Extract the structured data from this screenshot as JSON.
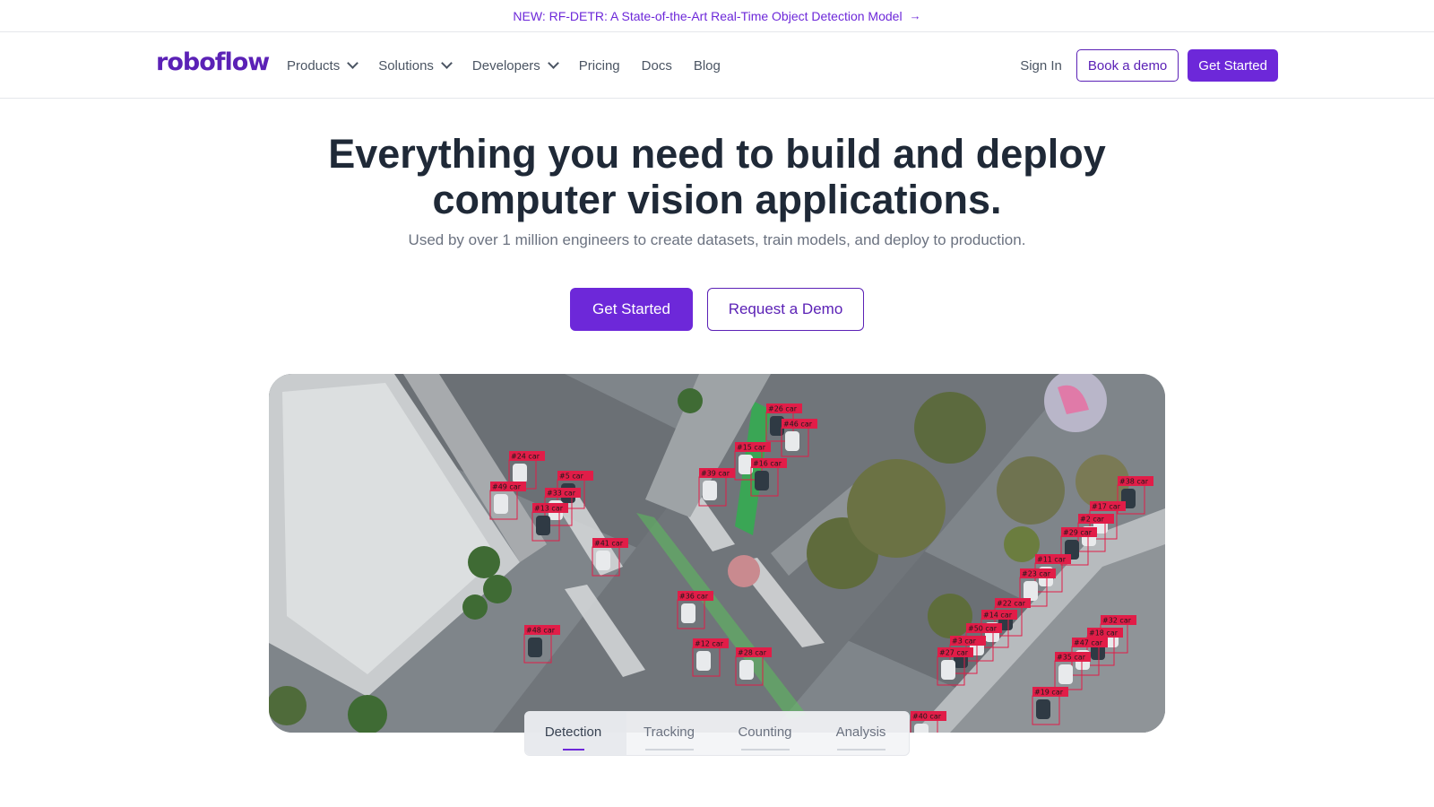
{
  "announcement": {
    "text": "NEW: RF-DETR: A State-of-the-Art Real-Time Object Detection Model",
    "arrow": "→"
  },
  "nav": {
    "logo": "roboflow",
    "items": [
      {
        "label": "Products",
        "dropdown": true
      },
      {
        "label": "Solutions",
        "dropdown": true
      },
      {
        "label": "Developers",
        "dropdown": true
      },
      {
        "label": "Pricing",
        "dropdown": false
      },
      {
        "label": "Docs",
        "dropdown": false
      },
      {
        "label": "Blog",
        "dropdown": false
      }
    ],
    "sign_in": "Sign In",
    "book_demo": "Book a demo",
    "get_started": "Get Started"
  },
  "hero": {
    "title_line1": "Everything you need to build and deploy",
    "title_line2": "computer vision applications.",
    "subtitle": "Used by over 1 million engineers to create datasets, train models, and deploy to production.",
    "primary_cta": "Get Started",
    "secondary_cta": "Request a Demo"
  },
  "demo": {
    "detections": [
      {
        "label": "#26 car"
      },
      {
        "label": "#46 car"
      },
      {
        "label": "#15 car"
      },
      {
        "label": "#16 car"
      },
      {
        "label": "#39 car"
      },
      {
        "label": "#24 car"
      },
      {
        "label": "#5 car"
      },
      {
        "label": "#49 car"
      },
      {
        "label": "#33 car"
      },
      {
        "label": "#13 car"
      },
      {
        "label": "#41 car"
      },
      {
        "label": "#36 car"
      },
      {
        "label": "#48 car"
      },
      {
        "label": "#12 car"
      },
      {
        "label": "#28 car"
      },
      {
        "label": "#38 car"
      },
      {
        "label": "#17 car"
      },
      {
        "label": "#2 car"
      },
      {
        "label": "#29 car"
      },
      {
        "label": "#11 car"
      },
      {
        "label": "#23 car"
      },
      {
        "label": "#22 car"
      },
      {
        "label": "#14 car"
      },
      {
        "label": "#50 car"
      },
      {
        "label": "#3 car"
      },
      {
        "label": "#27 car"
      },
      {
        "label": "#32 car"
      },
      {
        "label": "#18 car"
      },
      {
        "label": "#47 car"
      },
      {
        "label": "#35 car"
      },
      {
        "label": "#19 car"
      },
      {
        "label": "#40 car"
      }
    ],
    "tabs": [
      "Detection",
      "Tracking",
      "Counting",
      "Analysis"
    ],
    "active_tab": "Detection"
  },
  "colors": {
    "brand": "#6d28d9",
    "brand_dark": "#5b21b6",
    "detection_box": "#e11d48"
  }
}
